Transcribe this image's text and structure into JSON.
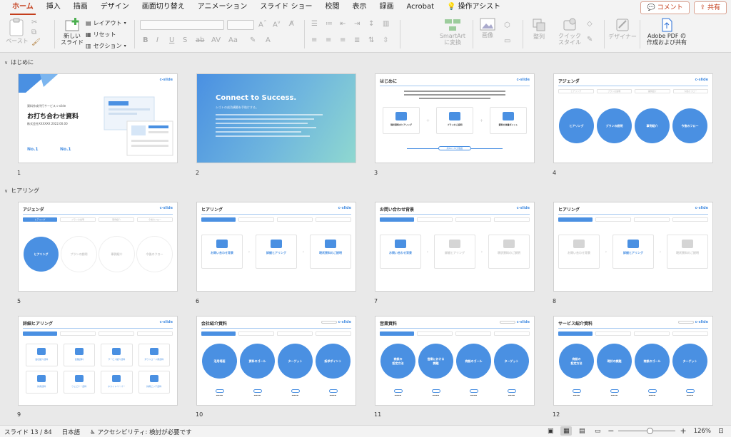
{
  "tabs": [
    "ホーム",
    "挿入",
    "描画",
    "デザイン",
    "画面切り替え",
    "アニメーション",
    "スライド ショー",
    "校閲",
    "表示",
    "録画",
    "Acrobat",
    "操作アシスト"
  ],
  "active_tab": "ホーム",
  "header_buttons": {
    "comment": "コメント",
    "share": "共有"
  },
  "ribbon": {
    "paste": "ペースト",
    "new_slide": "新しい\nスライド",
    "layout": "レイアウト",
    "reset": "リセット",
    "section": "セクション",
    "smartart": "SmartArt\nに変換",
    "picture": "画像",
    "arrange": "整列",
    "quick_style": "クイック\nスタイル",
    "designer": "デザイナー",
    "adobe": "Adobe PDF の\n作成および共有"
  },
  "sections": [
    {
      "name": "はじめに"
    },
    {
      "name": "ヒアリング"
    }
  ],
  "slides": [
    {
      "num": "1",
      "title": "お打ち合わせ資料",
      "sub": "株式会社XXXXXX 2022.00.00",
      "eyebrow": "資料作成代行サービス c-slide",
      "badge1": "No.1",
      "badge2": "No.1"
    },
    {
      "num": "2",
      "title": "Connect to Success.",
      "sub": "シゴトの成功構築を手助けする。"
    },
    {
      "num": "3",
      "title": "はじめに",
      "items": [
        "現状資料のヒアリング",
        "プランのご説明",
        "資料の改善ポイント"
      ],
      "footer": "約60〜70分程度"
    },
    {
      "num": "4",
      "title": "アジェンダ",
      "items": [
        "ヒアリング",
        "プランの説明",
        "事例紹介",
        "今後のフロー"
      ]
    },
    {
      "num": "5",
      "title": "アジェンダ",
      "items": [
        "ヒアリング",
        "プランの説明",
        "事例紹介",
        "今後のフロー"
      ]
    },
    {
      "num": "6",
      "title": "ヒアリング",
      "items": [
        "お問い合わせ背景",
        "詳細ヒアリング",
        "現状資料のご説明"
      ]
    },
    {
      "num": "7",
      "title": "お問い合わせ背景",
      "items": [
        "お問い合わせ背景",
        "詳細ヒアリング",
        "現状資料のご説明"
      ]
    },
    {
      "num": "8",
      "title": "ヒアリング",
      "items": [
        "お問い合わせ背景",
        "詳細ヒアリング",
        "現状資料のご説明"
      ]
    },
    {
      "num": "9",
      "title": "詳細ヒアリング",
      "items": [
        "会社紹介資料",
        "営業資料",
        "サービス紹介資料",
        "ダウンロード用資料",
        "採用資料",
        "ウェビナー資料",
        "ホワイトペーパー",
        "採用ピッチ資料"
      ]
    },
    {
      "num": "10",
      "title": "会社紹介資料",
      "items": [
        "活用場面",
        "資料のゴール",
        "ターゲット",
        "訴求ポイント"
      ]
    },
    {
      "num": "11",
      "title": "営業資料",
      "items": [
        "商談の\n設定方法",
        "営業における\n課題",
        "商談のゴール",
        "ターゲット"
      ]
    },
    {
      "num": "12",
      "title": "サービス紹介資料",
      "items": [
        "商談の\n設定方法",
        "現状の課題",
        "商談のゴール",
        "ターゲット"
      ]
    }
  ],
  "logo": "c-slide",
  "status": {
    "slide": "スライド 13 / 84",
    "language": "日本語",
    "accessibility": "アクセシビリティ: 検討が必要です",
    "zoom": "126%",
    "zoom_level": 0.55
  },
  "colors": {
    "accent": "#c43e1c",
    "brand": "#4a90e2"
  }
}
